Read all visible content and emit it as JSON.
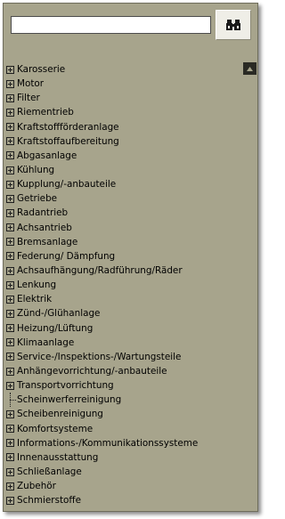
{
  "search": {
    "value": "",
    "placeholder": ""
  },
  "tree": {
    "items": [
      {
        "label": "Karosserie",
        "expandable": true
      },
      {
        "label": "Motor",
        "expandable": true
      },
      {
        "label": "Filter",
        "expandable": true
      },
      {
        "label": "Riementrieb",
        "expandable": true
      },
      {
        "label": "Kraftstoffförderanlage",
        "expandable": true
      },
      {
        "label": "Kraftstoffaufbereitung",
        "expandable": true
      },
      {
        "label": "Abgasanlage",
        "expandable": true
      },
      {
        "label": "Kühlung",
        "expandable": true
      },
      {
        "label": "Kupplung/-anbauteile",
        "expandable": true
      },
      {
        "label": "Getriebe",
        "expandable": true
      },
      {
        "label": "Radantrieb",
        "expandable": true
      },
      {
        "label": "Achsantrieb",
        "expandable": true
      },
      {
        "label": "Bremsanlage",
        "expandable": true
      },
      {
        "label": "Federung/ Dämpfung",
        "expandable": true
      },
      {
        "label": "Achsaufhängung/Radführung/Räder",
        "expandable": true
      },
      {
        "label": "Lenkung",
        "expandable": true
      },
      {
        "label": "Elektrik",
        "expandable": true
      },
      {
        "label": "Zünd-/Glühanlage",
        "expandable": true
      },
      {
        "label": "Heizung/Lüftung",
        "expandable": true
      },
      {
        "label": "Klimaanlage",
        "expandable": true
      },
      {
        "label": "Service-/Inspektions-/Wartungsteile",
        "expandable": true
      },
      {
        "label": "Anhängevorrichtung/-anbauteile",
        "expandable": true
      },
      {
        "label": "Transportvorrichtung",
        "expandable": true
      },
      {
        "label": "Scheinwerferreinigung",
        "expandable": false
      },
      {
        "label": "Scheibenreinigung",
        "expandable": true
      },
      {
        "label": "Komfortsysteme",
        "expandable": true
      },
      {
        "label": "Informations-/Kommunikationssysteme",
        "expandable": true
      },
      {
        "label": "Innenausstattung",
        "expandable": true
      },
      {
        "label": "Schließanlage",
        "expandable": true
      },
      {
        "label": "Zubehör",
        "expandable": true
      },
      {
        "label": "Schmierstoffe",
        "expandable": true
      }
    ]
  },
  "icons": {
    "search_button": "binoculars-icon",
    "expand": "plus-box-icon",
    "scroll_up": "arrow-up-icon"
  },
  "colors": {
    "panel_background": "#a7a48c",
    "text": "#000000",
    "scroll_button": "#2a2a24"
  }
}
